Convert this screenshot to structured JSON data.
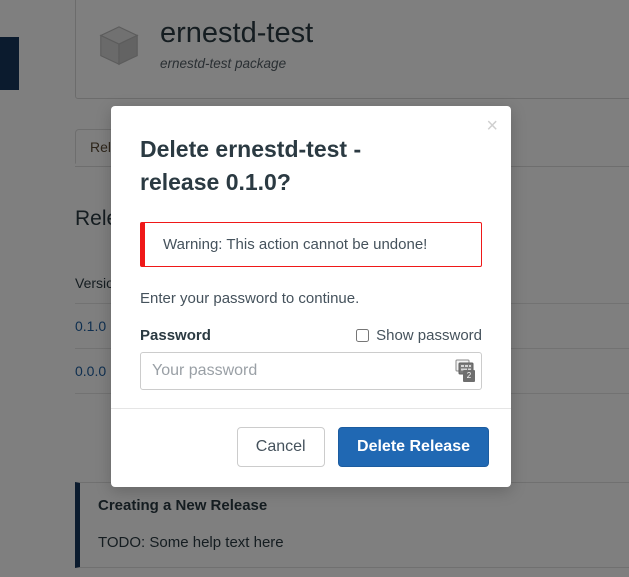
{
  "page": {
    "package": {
      "icon": "cube-icon",
      "title": "ernestd-test",
      "subtitle": "ernestd-test package"
    },
    "tabs": [
      {
        "label": "Releases"
      }
    ],
    "section_title": "Releases",
    "releases_table": {
      "columns": [
        "Version"
      ],
      "rows": [
        {
          "version": "0.1.0"
        },
        {
          "version": "0.0.0"
        }
      ]
    },
    "help_panel": {
      "title": "Creating a New Release",
      "body": "TODO: Some help text here"
    }
  },
  "modal": {
    "close_label": "×",
    "title": "Delete ernestd-test - release 0.1.0?",
    "warning": "Warning: This action cannot be undone!",
    "instruction": "Enter your password to continue.",
    "password_label": "Password",
    "show_password_label": "Show password",
    "password_value": "",
    "password_placeholder": "Your password",
    "password_manager_icon": "password-manager-icon",
    "password_manager_count": "2",
    "cancel_label": "Cancel",
    "confirm_label": "Delete Release"
  },
  "colors": {
    "primary": "#2068b3",
    "navbar": "#16365c",
    "danger": "#ef1818",
    "link": "#1f5fa0",
    "backdrop": "rgba(0,0,0,0.5)"
  }
}
